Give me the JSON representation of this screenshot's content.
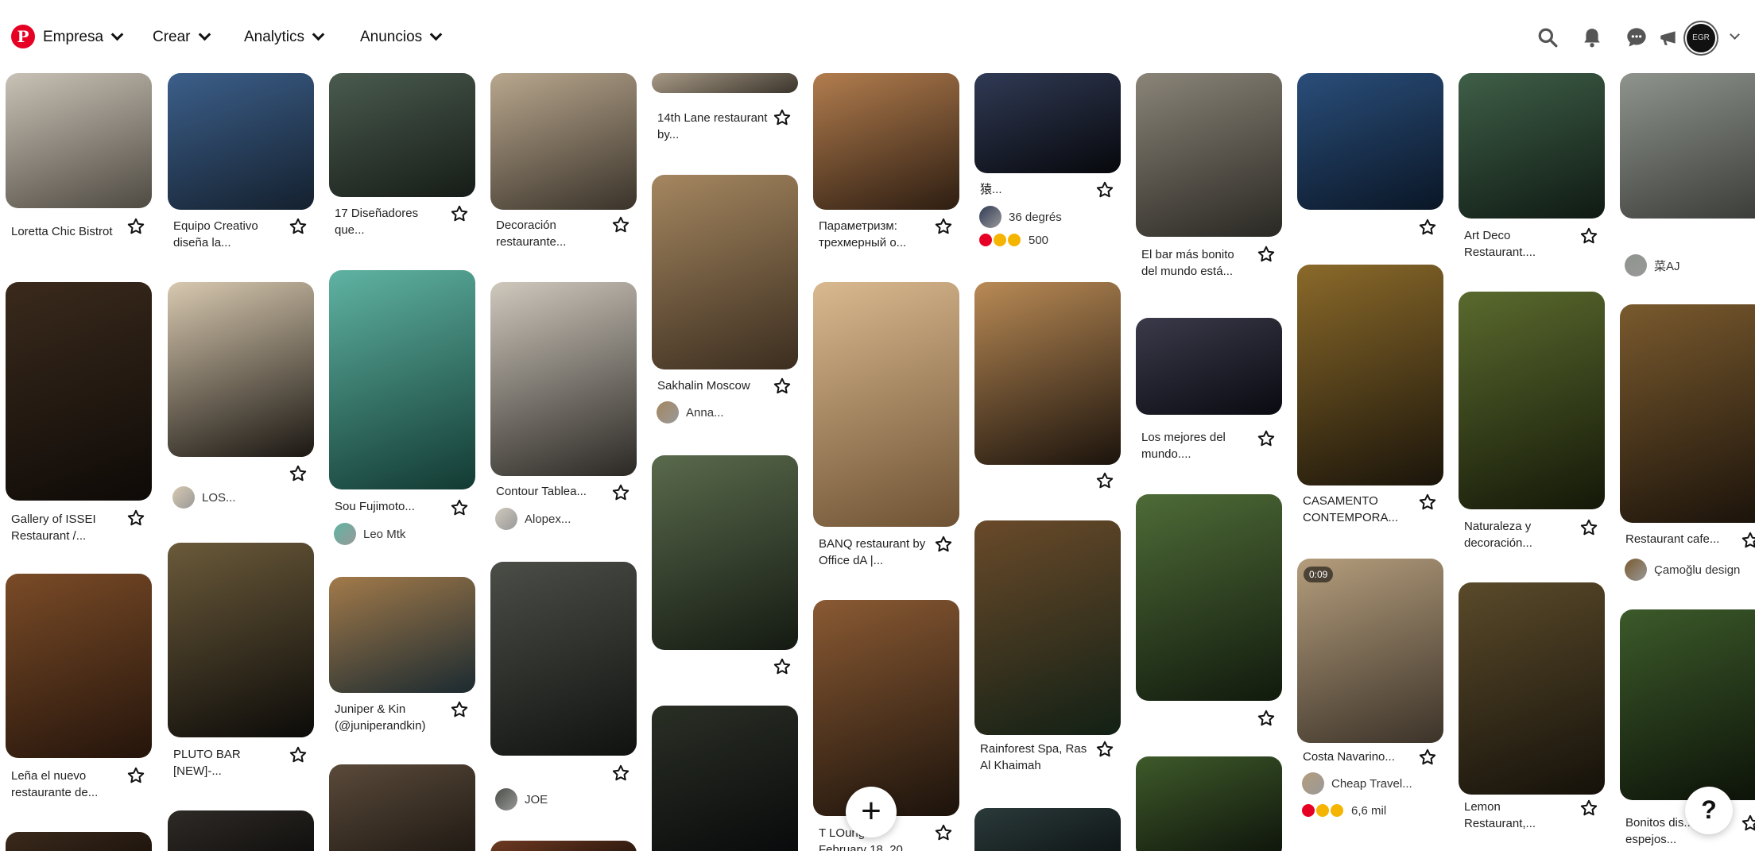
{
  "topbar": {
    "logo_letter": "P",
    "nav": [
      {
        "label": "Empresa"
      },
      {
        "label": "Crear"
      },
      {
        "label": "Analytics"
      },
      {
        "label": "Anuncios"
      }
    ],
    "avatar_label": "EGR"
  },
  "columns": [
    {
      "pins": [
        {
          "title": "Loretta Chic Bistrot",
          "colors": [
            "#c9c2b6",
            "#4f4a42"
          ]
        },
        {
          "title": "Gallery of ISSEI Restaurant /...",
          "colors": [
            "#3a2a1c",
            "#0e0a07"
          ]
        },
        {
          "title": "Leña el nuevo restaurante de...",
          "colors": [
            "#7a4b27",
            "#24140b"
          ]
        },
        {
          "title": "",
          "colors": [
            "#3b2a1c",
            "#140d08"
          ]
        }
      ]
    },
    {
      "pins": [
        {
          "title": "Equipo Creativo diseña la...",
          "colors": [
            "#3c5f8a",
            "#14202e"
          ]
        },
        {
          "title": "",
          "creator": "LOS...",
          "colors": [
            "#d8c9b0",
            "#1b1712"
          ]
        },
        {
          "title": "PLUTO BAR [NEW]-...",
          "colors": [
            "#6b5a3a",
            "#0c0b09"
          ]
        },
        {
          "title": "",
          "colors": [
            "#2e2a26",
            "#0b0a09"
          ]
        }
      ]
    },
    {
      "pins": [
        {
          "title": "17 Diseñadores que...",
          "colors": [
            "#4a5b4e",
            "#161c17"
          ]
        },
        {
          "title": "Sou Fujimoto...",
          "creator": "Leo Mtk",
          "colors": [
            "#5fb3a2",
            "#123a33"
          ]
        },
        {
          "title": "Juniper & Kin (@juniperandkin)",
          "colors": [
            "#a27a4a",
            "#1b2a30"
          ]
        },
        {
          "title": "",
          "colors": [
            "#5a4a3a",
            "#1a1510"
          ]
        }
      ]
    },
    {
      "pins": [
        {
          "title": "Decoración restaurante...",
          "colors": [
            "#b9a78e",
            "#3a332a"
          ]
        },
        {
          "title": "Contour Tablea...",
          "creator": "Alopex...",
          "colors": [
            "#cfc8bd",
            "#2b2824"
          ]
        },
        {
          "title": "",
          "creator": "JOE",
          "colors": [
            "#4b4e47",
            "#101210"
          ]
        },
        {
          "title": "",
          "colors": [
            "#6e3a22",
            "#1a0e08"
          ]
        }
      ]
    },
    {
      "pins": [
        {
          "title": "14th Lane restaurant by...",
          "colors": [
            "#a89a86",
            "#3a342c"
          ]
        },
        {
          "title": "Sakhalin Moscow",
          "creator": "Anna...",
          "colors": [
            "#a58760",
            "#3b2d1f"
          ]
        },
        {
          "title": "",
          "colors": [
            "#5a6a4c",
            "#141a12"
          ]
        },
        {
          "title": "",
          "colors": [
            "#2a2f25",
            "#07080a"
          ]
        }
      ]
    },
    {
      "pins": [
        {
          "title": "Параметризм: трехмерный о...",
          "colors": [
            "#b27d4e",
            "#2d1d11"
          ]
        },
        {
          "title": "BANQ restaurant by Office dA |...",
          "colors": [
            "#d9b98f",
            "#6e5233"
          ]
        },
        {
          "title": "T LOunge",
          "title2": "February 18, 20",
          "colors": [
            "#8a5a33",
            "#1b120b"
          ]
        }
      ]
    },
    {
      "pins": [
        {
          "title": "猿...",
          "creator": "36 degrés",
          "reactions": "500",
          "colors": [
            "#303a55",
            "#07080c"
          ]
        },
        {
          "title": "",
          "colors": [
            "#b98a55",
            "#1b130c"
          ]
        },
        {
          "title": "Rainforest Spa, Ras Al Khaimah",
          "colors": [
            "#6a4a2a",
            "#122015"
          ]
        },
        {
          "title": "",
          "colors": [
            "#2b3a3a",
            "#0a0f10"
          ]
        }
      ]
    },
    {
      "pins": [
        {
          "title": "El bar más bonito del mundo está...",
          "colors": [
            "#8a8478",
            "#2a2823"
          ]
        },
        {
          "title": "Los mejores del mundo....",
          "colors": [
            "#3a3a4a",
            "#0a0a12"
          ]
        },
        {
          "title": "",
          "colors": [
            "#4e6b37",
            "#111a0d"
          ]
        },
        {
          "title": "",
          "colors": [
            "#3e5a2a",
            "#0d120a"
          ]
        }
      ]
    },
    {
      "pins": [
        {
          "title": "",
          "colors": [
            "#2a4e7a",
            "#0a1626"
          ]
        },
        {
          "title": "CASAMENTO CONTEMPORA...",
          "colors": [
            "#8b6a2a",
            "#1a140a"
          ]
        },
        {
          "title": "Costa Navarino...",
          "creator": "Cheap Travel...",
          "reactions": "6,6 mil",
          "badge": "0:09",
          "colors": [
            "#b49d7c",
            "#3c3329"
          ]
        }
      ]
    },
    {
      "pins": [
        {
          "title": "Art Deco Restaurant....",
          "colors": [
            "#3f5f48",
            "#0f1a13"
          ]
        },
        {
          "title": "Naturaleza y decoración...",
          "colors": [
            "#5a6a2e",
            "#141808"
          ]
        },
        {
          "title": "Lemon Restaurant,...",
          "colors": [
            "#5a4a2a",
            "#15110a"
          ]
        }
      ]
    },
    {
      "pins": [
        {
          "title": "",
          "creator": "菜AJ",
          "colors": [
            "#8f948d",
            "#3a3c38"
          ]
        },
        {
          "title": "Restaurant cafe...",
          "creator": "Çamoğlu design",
          "colors": [
            "#7a5a2e",
            "#1a120a"
          ]
        },
        {
          "title": "Bonitos dis... de espejos...",
          "colors": [
            "#3c5a2a",
            "#0c1208"
          ]
        }
      ]
    }
  ],
  "fab_symbol": "+",
  "help_symbol": "?",
  "colors": {
    "brand": "#e60023",
    "text": "#111111",
    "heart": "#e60023",
    "wow": "#f5b400"
  }
}
